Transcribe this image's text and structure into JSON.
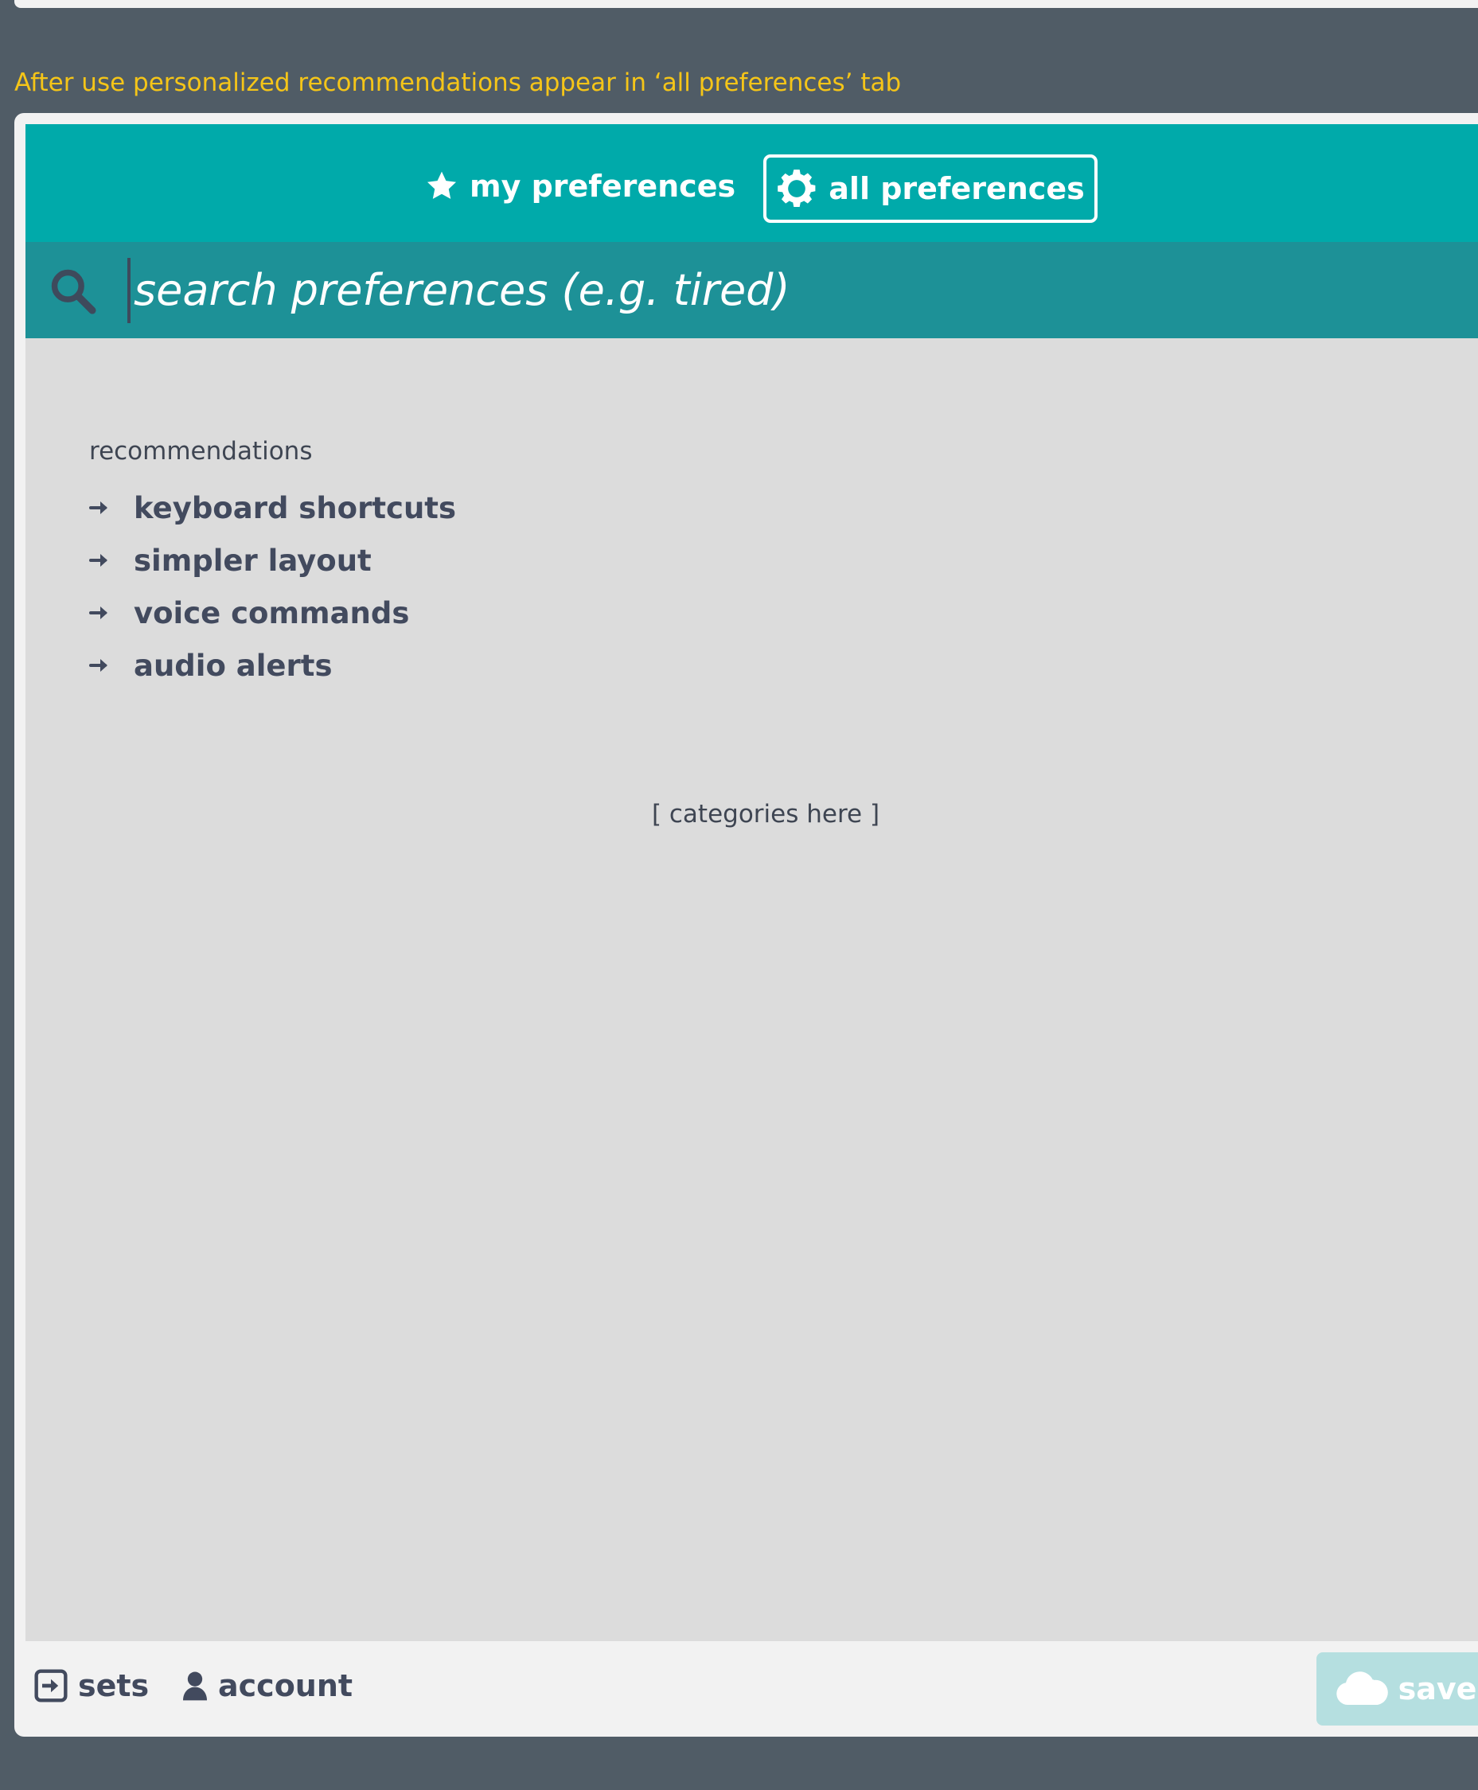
{
  "caption": "After use personalized recommendations appear in ‘all preferences’ tab",
  "tabs": {
    "my": {
      "label": "my preferences",
      "icon": "star-icon"
    },
    "all": {
      "label": "all preferences",
      "icon": "gear-icon",
      "selected": true
    }
  },
  "search": {
    "placeholder": "search preferences (e.g. tired)",
    "value": ""
  },
  "recommendations": {
    "heading": "recommendations",
    "items": [
      {
        "label": "keyboard shortcuts"
      },
      {
        "label": "simpler layout"
      },
      {
        "label": "voice commands"
      },
      {
        "label": "audio alerts"
      }
    ]
  },
  "categories_note": "[ categories here ]",
  "footer": {
    "sets_label": "sets",
    "account_label": "account",
    "save_label": "save"
  },
  "colors": {
    "page_bg": "#505c66",
    "header_bg": "#00aaaa",
    "search_bg": "#1d9197",
    "content_bg": "#dcdcdc",
    "caption": "#f5c518",
    "text": "#424a5e",
    "save_bg": "#b5dfe0"
  }
}
